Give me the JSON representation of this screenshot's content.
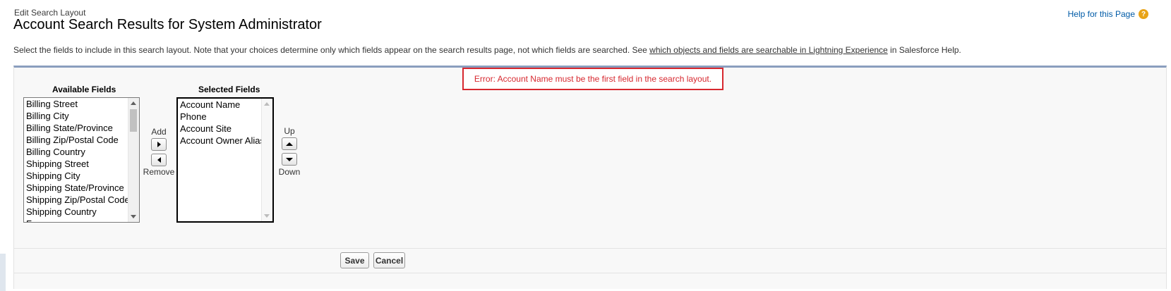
{
  "header": {
    "subtitle": "Edit Search Layout",
    "title": "Account Search Results for System Administrator",
    "help_link": "Help for this Page",
    "help_icon": "help-circle-icon"
  },
  "description": {
    "text_before": "Select the fields to include in this search layout. Note that your choices determine only which fields appear on the search results page, not which fields are searched. See ",
    "link": "which objects and fields are searchable in Lightning Experience",
    "text_after": " in Salesforce Help."
  },
  "error": {
    "message": "Error: Account Name must be the first field in the search layout.",
    "color": "#d7282f"
  },
  "available": {
    "header": "Available Fields",
    "items": [
      "Billing Street",
      "Billing City",
      "Billing State/Province",
      "Billing Zip/Postal Code",
      "Billing Country",
      "Shipping Street",
      "Shipping City",
      "Shipping State/Province",
      "Shipping Zip/Postal Code",
      "Shipping Country",
      "Fax"
    ]
  },
  "selected": {
    "header": "Selected Fields",
    "items": [
      "Account Name",
      "Phone",
      "Account Site",
      "Account Owner Alias"
    ]
  },
  "transfer": {
    "add_label": "Add",
    "remove_label": "Remove"
  },
  "order": {
    "up_label": "Up",
    "down_label": "Down"
  },
  "buttons": {
    "save": "Save",
    "cancel": "Cancel"
  }
}
